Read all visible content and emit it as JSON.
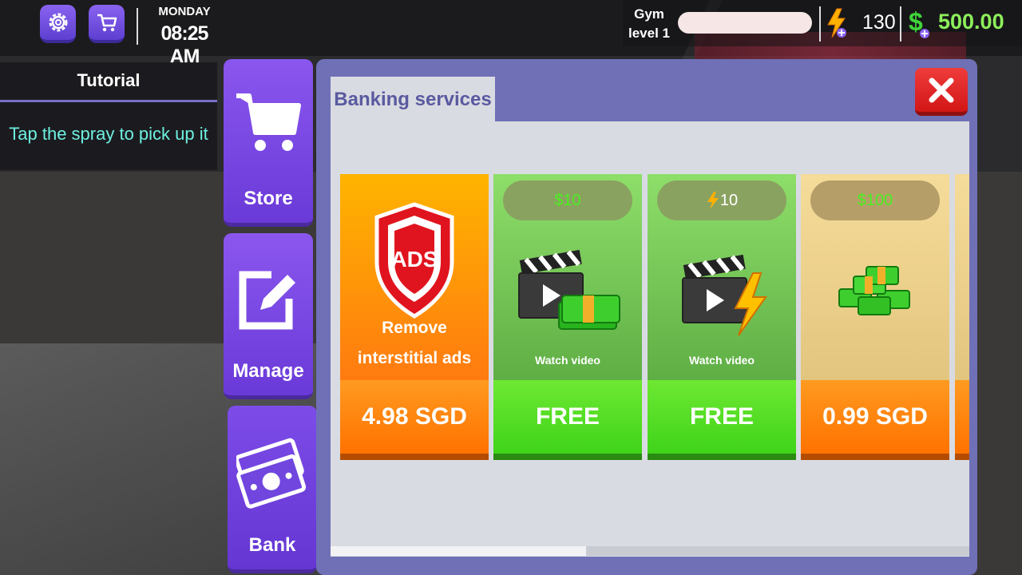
{
  "topbar": {
    "day": "MONDAY",
    "time": "08:25 AM",
    "gym_label_line1": "Gym",
    "gym_label_line2": "level 1",
    "energy": "130",
    "cash": "500.00"
  },
  "tutorial": {
    "title": "Tutorial",
    "text": "Tap the spray to pick up it"
  },
  "side_menu": {
    "store_label": "Store",
    "manage_label": "Manage",
    "bank_label": "Bank"
  },
  "panel": {
    "tab_label": "Banking services"
  },
  "cards": [
    {
      "line1": "Remove",
      "line2": "interstitial ads",
      "price": "4.98 SGD"
    },
    {
      "cost": "$10",
      "caption": "Watch video",
      "price": "FREE"
    },
    {
      "cost": "10",
      "caption": "Watch video",
      "price": "FREE"
    },
    {
      "cost": "$100",
      "price": "0.99 SGD"
    }
  ],
  "colors": {
    "accent_purple": "#7a4ee6",
    "cash_green": "#8cf05a",
    "orange_btn": "#ff8a10",
    "green_btn": "#4fd81e"
  }
}
